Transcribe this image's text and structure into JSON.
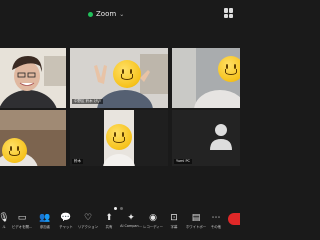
{
  "app": {
    "title": "Zoom"
  },
  "participants": [
    {
      "name": ""
    },
    {
      "name": "中野区 鈴木 けい"
    },
    {
      "name": ""
    },
    {
      "name": ""
    },
    {
      "name": "鈴木"
    },
    {
      "name": "Yumi PC"
    }
  ],
  "toolbar": [
    {
      "label": "ル",
      "icon": "mic-icon"
    },
    {
      "label": "ビデオを開...",
      "icon": "video-icon"
    },
    {
      "label": "参加者",
      "icon": "participants-icon"
    },
    {
      "label": "チャット",
      "icon": "chat-icon"
    },
    {
      "label": "リアクション",
      "icon": "reactions-icon"
    },
    {
      "label": "共有",
      "icon": "share-icon"
    },
    {
      "label": "AI Compan...",
      "icon": "ai-companion-icon"
    },
    {
      "label": "レコーディー",
      "icon": "record-icon"
    },
    {
      "label": "字幕",
      "icon": "captions-icon"
    },
    {
      "label": "ホワイトボー",
      "icon": "whiteboard-icon"
    },
    {
      "label": "その他",
      "icon": "more-icon"
    }
  ],
  "colors": {
    "background": "#1a1a1a",
    "security": "#21c15b",
    "end": "#e02828"
  }
}
